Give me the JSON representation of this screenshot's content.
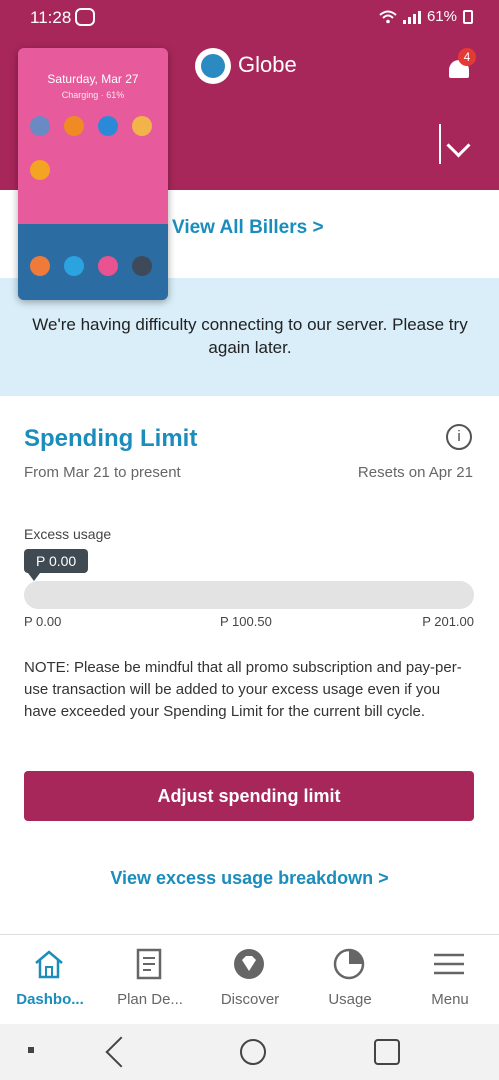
{
  "status_bar": {
    "time": "11:28",
    "battery": "61%"
  },
  "header": {
    "brand": "Globe",
    "notifications_count": "4"
  },
  "overlay": {
    "date": "Saturday, Mar 27",
    "charging": "Charging · 61%"
  },
  "billers": {
    "view_all": "View All Billers >"
  },
  "error": {
    "message": "We're having difficulty connecting to our server. Please try again later."
  },
  "spending_limit": {
    "title": "Spending Limit",
    "period": "From Mar 21 to present",
    "resets": "Resets on Apr 21",
    "excess_label": "Excess usage",
    "current_value": "P 0.00",
    "fill_fraction": 0,
    "scale": {
      "min": "P 0.00",
      "mid": "P 100.50",
      "max": "P 201.00"
    },
    "note": "NOTE: Please be mindful that all promo subscription and pay-per-use transaction will be added to your excess usage even if you have exceeded your Spending Limit for the current bill cycle.",
    "adjust_button": "Adjust spending limit",
    "breakdown_link": "View excess usage breakdown >"
  },
  "bottom_nav": {
    "items": [
      {
        "label": "Dashbo...",
        "icon": "home-icon",
        "active": true
      },
      {
        "label": "Plan De...",
        "icon": "document-icon",
        "active": false
      },
      {
        "label": "Discover",
        "icon": "diamond-icon",
        "active": false
      },
      {
        "label": "Usage",
        "icon": "pie-chart-icon",
        "active": false
      },
      {
        "label": "Menu",
        "icon": "hamburger-icon",
        "active": false
      }
    ]
  },
  "colors": {
    "brand": "#a8275a",
    "link": "#1a8dbd",
    "banner": "#d9eef9"
  }
}
